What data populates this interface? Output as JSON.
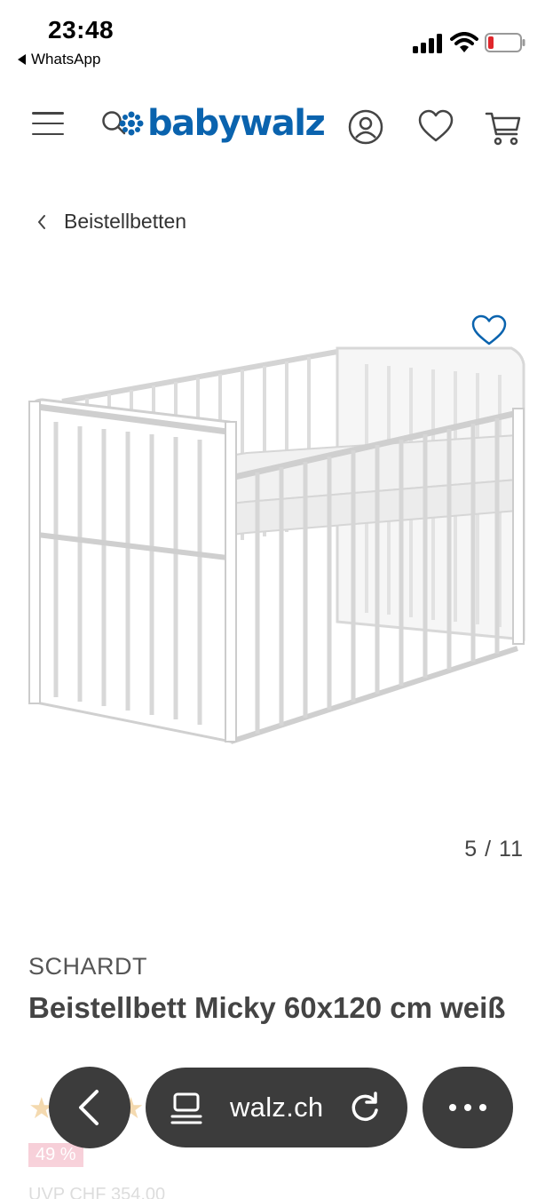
{
  "status_bar": {
    "time": "23:48",
    "back_app": "WhatsApp"
  },
  "header": {
    "logo_text": "babywalz",
    "brand_color": "#0a63ae",
    "icons": [
      "menu-icon",
      "search-icon",
      "user-icon",
      "heart-icon",
      "cart-icon"
    ]
  },
  "breadcrumb": {
    "label": "Beistellbetten"
  },
  "gallery": {
    "pager": "5 / 11"
  },
  "product": {
    "brand": "SCHARDT",
    "title": "Beistellbett Micky 60x120 cm weiß",
    "rating_stars": 4,
    "rating_max": 5,
    "discount": "49 %",
    "uvp": "UVP CHF 354.00"
  },
  "browser_toolbar": {
    "url": "walz.ch"
  }
}
